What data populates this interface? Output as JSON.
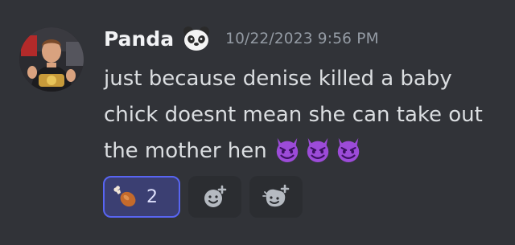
{
  "message": {
    "author": "Panda",
    "badge_icon": "panda-face-icon",
    "timestamp": "10/22/2023 9:56 PM",
    "text": "just because denise killed a baby chick doesnt mean she can take out the mother hen",
    "inline_emojis": [
      "smiling-imp-icon",
      "smiling-imp-icon",
      "smiling-imp-icon"
    ]
  },
  "reactions": [
    {
      "icon": "poultry-leg-icon",
      "count": "2",
      "active": true
    }
  ],
  "reaction_buttons": [
    {
      "icon": "add-reaction-icon"
    },
    {
      "icon": "add-super-reaction-icon"
    }
  ],
  "colors": {
    "background": "#313338",
    "author": "#f2f3f5",
    "timestamp": "#949ba4",
    "text": "#dbdee1",
    "reaction_active_bg": "#3b3f72",
    "reaction_active_border": "#5865f2",
    "emoji_purple": "#9c4bd8"
  }
}
